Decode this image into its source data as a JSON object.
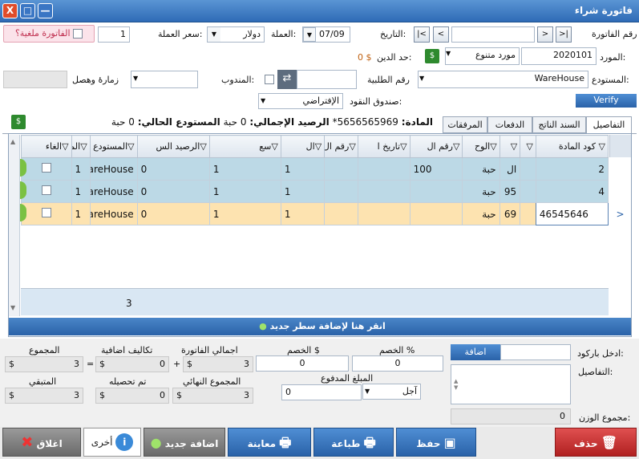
{
  "window": {
    "title": "فاتورة شراء",
    "close": "X",
    "maximize": "□",
    "minimize": "—"
  },
  "header": {
    "invoice_no_label": "رقم الفاتورة",
    "invoice_no_value": "",
    "nav_first": ">|",
    "nav_prev": ">",
    "nav_next": "<",
    "nav_last": "|<",
    "date_label": "التاريخ:",
    "date_value": "07/09",
    "currency_label": "العملة:",
    "currency_value": "دولار",
    "rate_label": "سعر العملة:",
    "rate_value": "1",
    "cancelled_label": "الفاتورة ملغية؟",
    "supplier_label": "المورد:",
    "supplier_code": "2020101",
    "supplier_name": "مورد متنوع",
    "debt_label": "حد الدين:",
    "debt_value": "0 $",
    "warehouse_label": "المستودع:",
    "warehouse_value": "WareHouse",
    "order_label": "رقم الطلبية",
    "rep_label": "المندوب:",
    "visit_label": "زمارهٔ وهصل",
    "cashbox_label": "صندوق النقود:",
    "cashbox_value": "الإفتراضي",
    "verify": "Verify"
  },
  "tabs": [
    "التفاصيل",
    "السند الناتج",
    "الدفعات",
    "المرفقات"
  ],
  "info": {
    "item_label": "المادة:",
    "item_value": "5656565969*",
    "balance_label": "الرصيد الإجمالي:",
    "balance_value": "0",
    "unit1": "حبة",
    "current_label": "المستودع الحالي:",
    "current_value": "0",
    "unit2": "حبة"
  },
  "grid": {
    "columns": [
      "كود المادة",
      "",
      "الوح",
      "رقم ال",
      "تاريخ ا",
      "رقم ال",
      "ال",
      "سع",
      "الرصيد الس",
      "المستودع",
      "المجم",
      "",
      "الغاء"
    ],
    "rows": [
      [
        "2",
        "",
        "ال",
        "حبة",
        "100",
        "",
        "",
        "1",
        "1",
        "0",
        "WareHouse",
        "1"
      ],
      [
        "4",
        "",
        "95",
        "حبة",
        "",
        "",
        "",
        "1",
        "1",
        "0",
        "WareHouse",
        "1"
      ],
      [
        "46545646",
        "",
        "69",
        "حبة",
        "",
        "",
        "",
        "1",
        "1",
        "0",
        "WareHouse",
        "1"
      ]
    ],
    "footer_total": "3",
    "add_row": "انقر هنا لإضافة سطر جديد"
  },
  "totals": {
    "total_label": "المجموع",
    "total_value": "3",
    "extra_label": "تكاليف اضافية",
    "extra_value": "0",
    "invoice_total_label": "اجمالي الفاتورة",
    "invoice_total_value": "3",
    "remaining_label": "المتبقي",
    "remaining_value": "3",
    "collected_label": "تم تحصيله",
    "collected_value": "0",
    "final_label": "المجموع النهائي",
    "final_value": "3",
    "currency": "$",
    "plus": "+",
    "equals": "=",
    "discount_amount_label": "الخصم $",
    "discount_amount_value": "0",
    "discount_pct_label": "الخصم %",
    "discount_pct_value": "0",
    "paid_label": "المبلغ المدفوع",
    "paid_value": "0",
    "paid_type": "آجل"
  },
  "barcode": {
    "label": "ادخل باركود:",
    "add": "اضافة",
    "details_label": "التفاصيل:",
    "weight_label": "مجموع الوزن:",
    "weight_value": "0"
  },
  "buttons": {
    "close": "اغلاق",
    "other": "أخرى",
    "add_new": "اضافة جديد",
    "preview": "معاينة",
    "print": "طباعة",
    "save": "حفظ",
    "delete": "حذف"
  }
}
